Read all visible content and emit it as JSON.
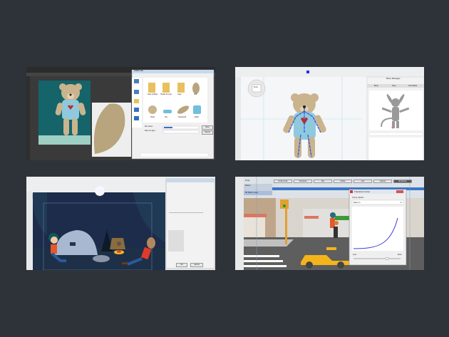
{
  "colors": {
    "background": "#2d3339",
    "teddy": "#c9b48e",
    "overalls": "#8fc9de",
    "heart": "#c62828",
    "curve": "#3d3dd6",
    "taxi": "#f4b41a"
  },
  "panel1": {
    "dialog_title": "Save As",
    "file_name_label": "File name:",
    "save_type_label": "Save as type:",
    "save_button": "Save",
    "cancel_button": "Cancel",
    "folders": [
      "Face & Body",
      "Hands & Legs",
      "Legs",
      "Left"
    ],
    "files": [
      "Head",
      "Top",
      "Sweatcuff",
      "Right"
    ]
  },
  "panel2": {
    "panel_title": "Bone Manager",
    "tabs": [
      "Body",
      "Face",
      "Joint Mask"
    ],
    "nav_label": "Front"
  },
  "panel3": {
    "ok_button": "OK",
    "cancel_button": "Cancel"
  },
  "panel4": {
    "dialog_title": "Transition Curve",
    "curve_option_label": "Curve Option",
    "curve_option_value": "Ease In",
    "less_label": "Less",
    "more_label": "More",
    "timeline_buttons": [
      "Perfect Flip",
      "Transform",
      "Flip",
      "Visible",
      "Link",
      "Opacity",
      "3D Motion"
    ],
    "track_labels": [
      "Props",
      "Motion",
      "3D Motion Layer"
    ]
  }
}
